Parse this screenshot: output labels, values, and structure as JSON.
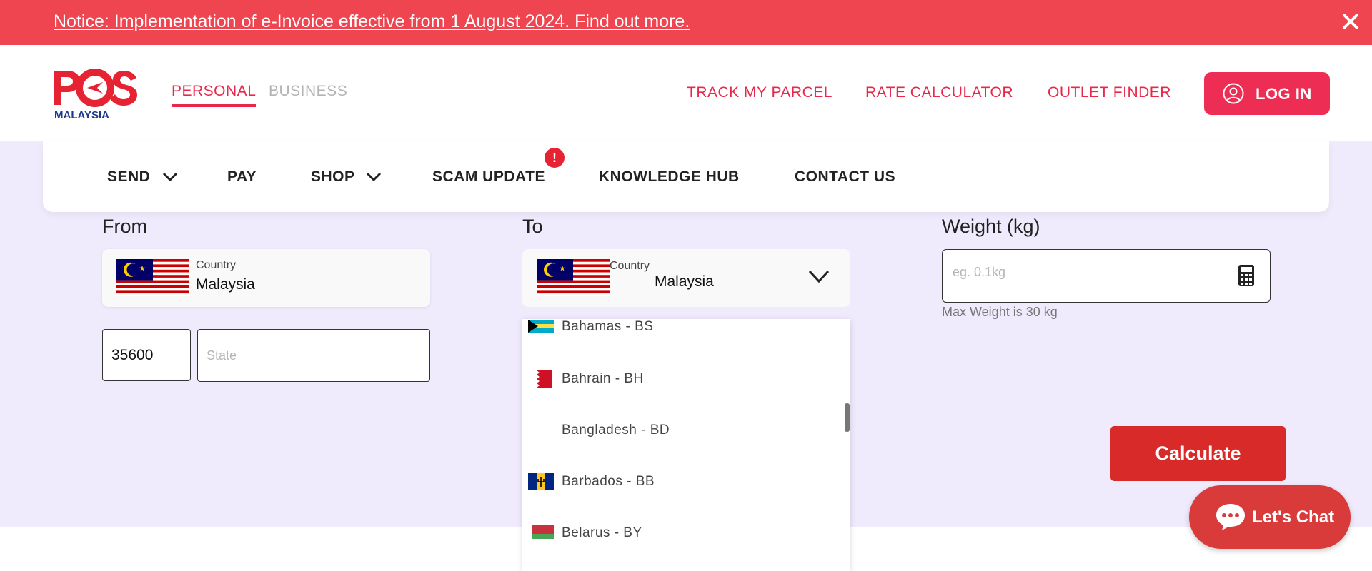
{
  "notice": {
    "text": "Notice: Implementation of e-Invoice effective from 1 August 2024. Find out more.",
    "close_icon": "close-icon",
    "bg": "#ee4550"
  },
  "header": {
    "logo_text": "POS",
    "logo_subtext": "MALAYSIA",
    "tabs": [
      {
        "label": "PERSONAL",
        "active": true
      },
      {
        "label": "BUSINESS",
        "active": false
      }
    ],
    "links": [
      "TRACK MY PARCEL",
      "RATE CALCULATOR",
      "OUTLET FINDER"
    ],
    "login_label": "LOG IN",
    "accent": "#e8284a"
  },
  "nav": {
    "items": [
      {
        "label": "SEND",
        "has_dropdown": true
      },
      {
        "label": "PAY",
        "has_dropdown": false
      },
      {
        "label": "SHOP",
        "has_dropdown": true
      },
      {
        "label": "SCAM UPDATE",
        "has_dropdown": false
      },
      {
        "label": "KNOWLEDGE HUB",
        "has_dropdown": false
      },
      {
        "label": "CONTACT US",
        "has_dropdown": false
      }
    ],
    "scam_badge": "!"
  },
  "form": {
    "from": {
      "label": "From",
      "country_label": "Country",
      "country_value": "Malaysia",
      "postcode": "35600",
      "state_placeholder": "State"
    },
    "to": {
      "label": "To",
      "country_label": "Country",
      "country_value": "Malaysia"
    },
    "weight": {
      "label": "Weight (kg)",
      "placeholder": "eg. 0.1kg",
      "hint": "Max Weight is 30 kg"
    },
    "calculate_label": "Calculate"
  },
  "dropdown_options": [
    {
      "label": "Bahamas - BS",
      "flag": "bahamas-flag"
    },
    {
      "label": "Bahrain - BH",
      "flag": "bahrain-flag"
    },
    {
      "label": "Bangladesh - BD",
      "flag": "none"
    },
    {
      "label": "Barbados - BB",
      "flag": "barbados-flag"
    },
    {
      "label": "Belarus - BY",
      "flag": "belarus-flag"
    }
  ],
  "chat": {
    "label": "Let's Chat"
  }
}
